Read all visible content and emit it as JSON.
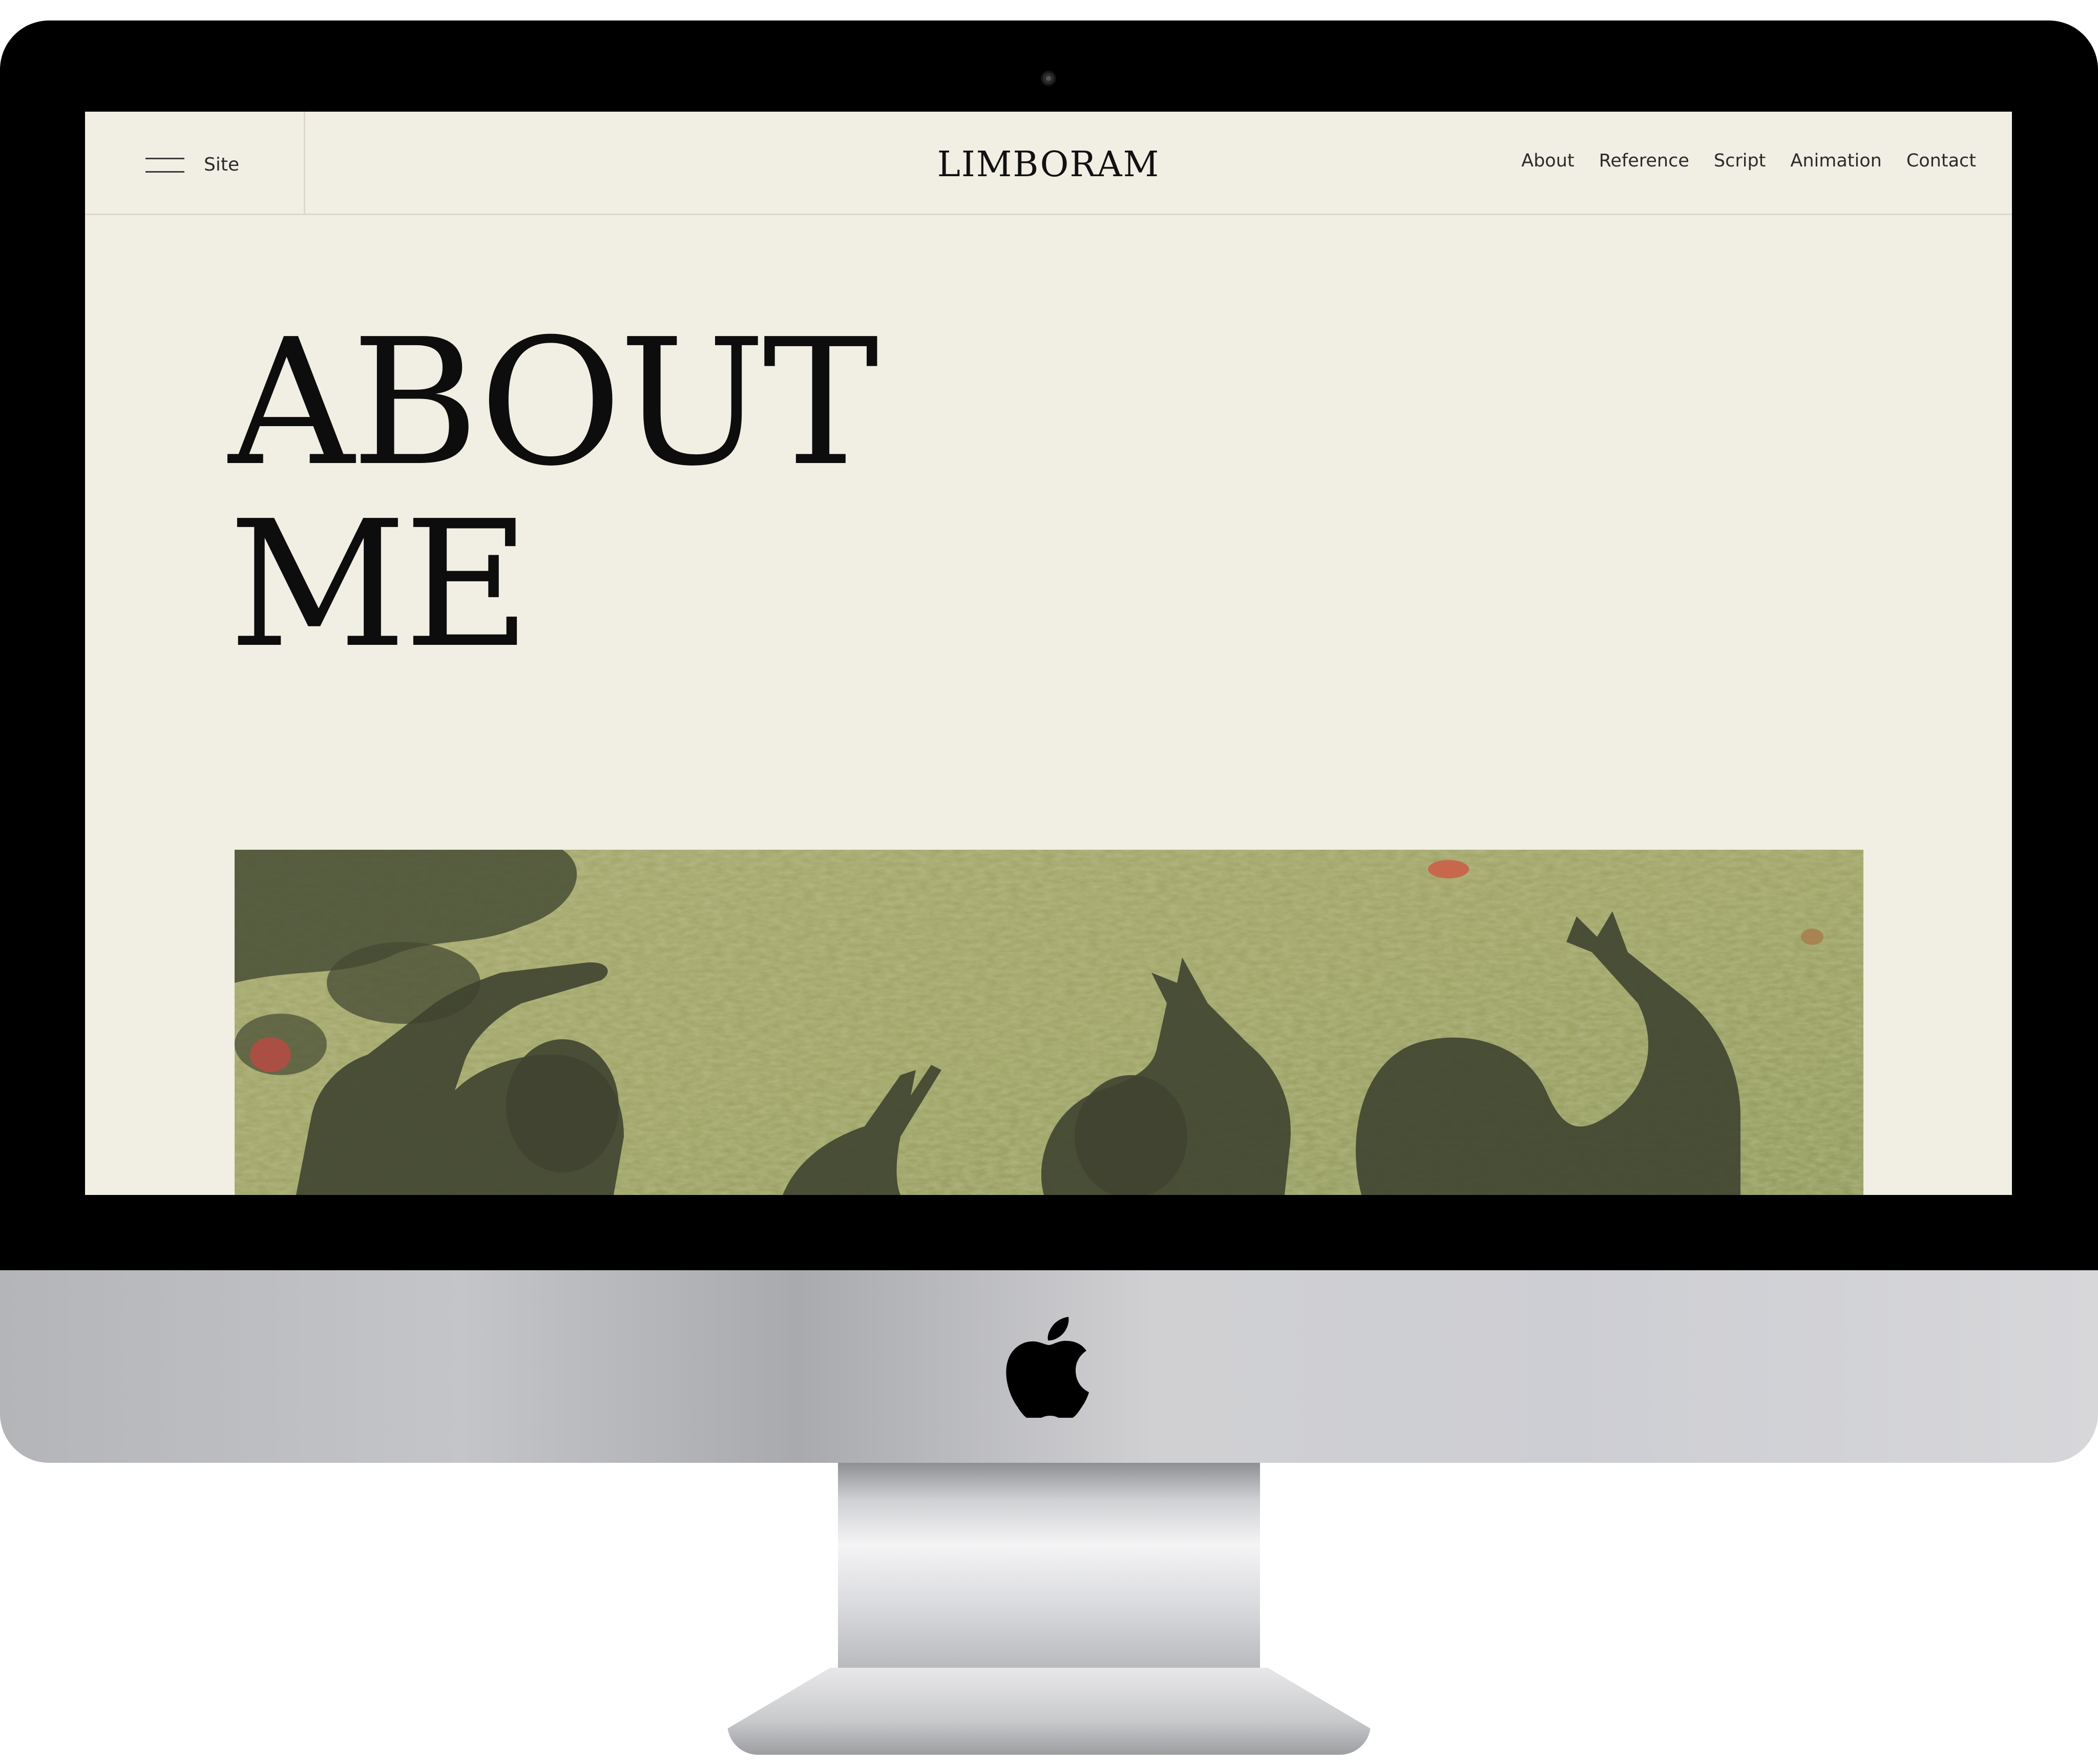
{
  "site": {
    "menu_label": "Site",
    "brand": "LIMBORAM",
    "nav": [
      {
        "label": "About"
      },
      {
        "label": "Reference"
      },
      {
        "label": "Script"
      },
      {
        "label": "Animation"
      },
      {
        "label": "Contact"
      }
    ]
  },
  "hero": {
    "title_line1": "ABOUT",
    "title_line2": "ME"
  },
  "icons": {
    "menu": "hamburger-icon",
    "device_logo": "apple-logo-icon"
  },
  "colors": {
    "page_background": "#f1eee4",
    "text": "#111111",
    "divider": "#dcd8cc",
    "bezel": "#000000"
  }
}
